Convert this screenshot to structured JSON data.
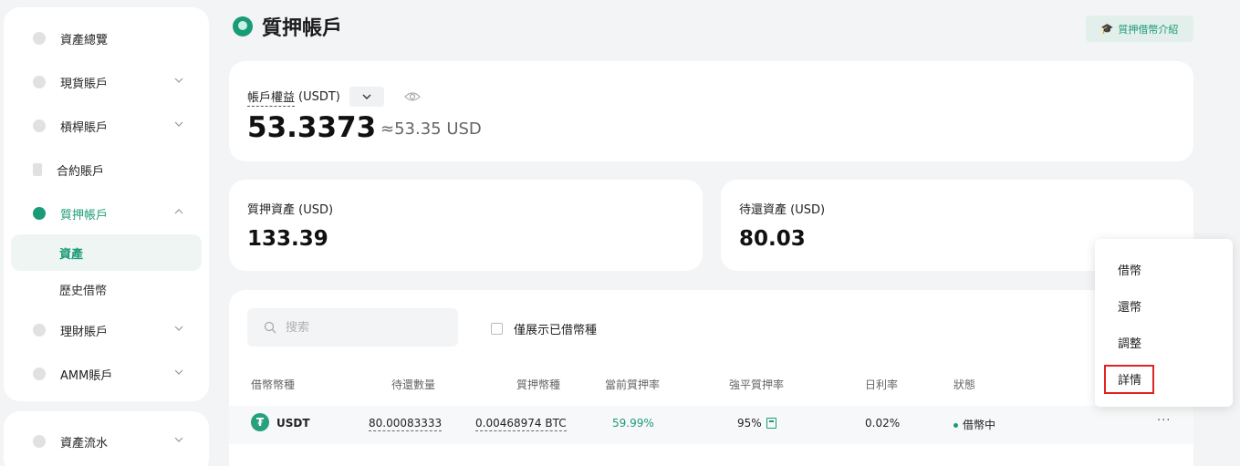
{
  "sidebar": {
    "items": [
      {
        "label": "資產總覽"
      },
      {
        "label": "現貨賬戶"
      },
      {
        "label": "槓桿賬戶"
      },
      {
        "label": "合約賬戶"
      },
      {
        "label": "質押帳戶"
      },
      {
        "label": "理財賬戶"
      },
      {
        "label": "AMM賬戶"
      }
    ],
    "sub_items": [
      {
        "label": "資產"
      },
      {
        "label": "歷史借幣"
      }
    ],
    "bottom_items": [
      {
        "label": "資產流水"
      }
    ]
  },
  "header": {
    "title": "質押帳戶",
    "intro_button": "質押借幣介紹"
  },
  "equity": {
    "label": "帳戶權益",
    "unit": "(USDT)",
    "value": "53.3373",
    "approx": "≈53.35 USD"
  },
  "stats": {
    "collateral_label": "質押資產 (USD)",
    "collateral_value": "133.39",
    "pending_label": "待還資產 (USD)",
    "pending_value": "80.03"
  },
  "table": {
    "search_placeholder": "搜索",
    "only_borrowed_label": "僅展示已借幣種",
    "columns": [
      "借幣幣種",
      "待還數量",
      "質押幣種",
      "當前質押率",
      "強平質押率",
      "日利率",
      "狀態"
    ],
    "rows": [
      {
        "coin_icon": "₮",
        "coin": "USDT",
        "pending": "80.00083333",
        "collateral": "0.00468974 BTC",
        "current_rate": "59.99%",
        "liq_rate": "95%",
        "daily_rate": "0.02%",
        "status": "借幣中",
        "more": "···"
      }
    ]
  },
  "menu": {
    "items": [
      "借幣",
      "還幣",
      "調整",
      "詳情"
    ]
  },
  "colors": {
    "accent": "#1a9b77",
    "highlight": "#e02424"
  }
}
